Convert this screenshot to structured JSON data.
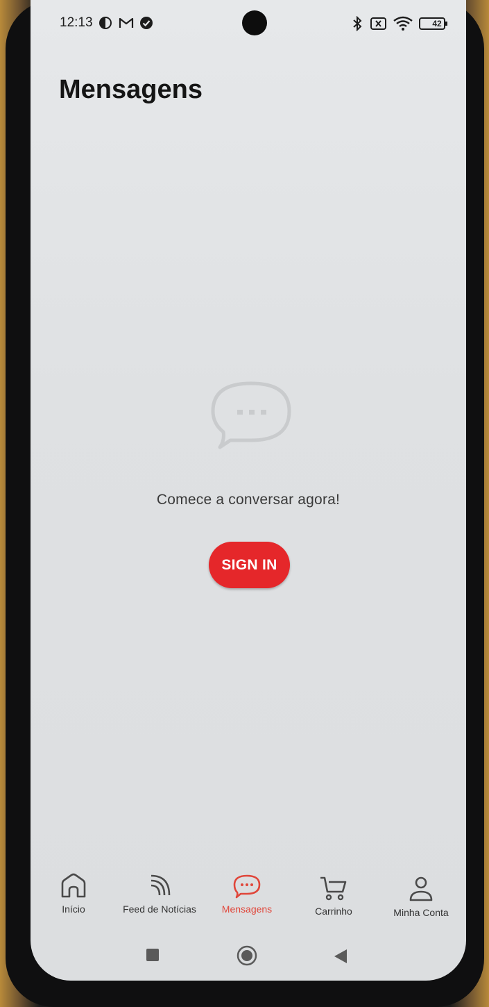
{
  "status_bar": {
    "time": "12:13",
    "battery": "42",
    "icons": [
      "data-saver-icon",
      "gmail-icon",
      "check-circle-icon",
      "bluetooth-icon",
      "no-sim-icon",
      "wifi-icon",
      "battery-icon"
    ]
  },
  "header": {
    "title": "Mensagens"
  },
  "empty_state": {
    "icon": "chat-bubble-icon",
    "message": "Comece a conversar agora!",
    "button_label": "SIGN IN"
  },
  "bottom_nav": {
    "items": [
      {
        "label": "Início",
        "icon": "home-icon",
        "active": false
      },
      {
        "label": "Feed de Notícias",
        "icon": "rss-feed-icon",
        "active": false
      },
      {
        "label": "Mensagens",
        "icon": "chat-icon",
        "active": true
      },
      {
        "label": "Carrinho",
        "icon": "cart-icon",
        "active": false
      },
      {
        "label": "Minha Conta",
        "icon": "user-icon",
        "active": false
      }
    ]
  },
  "system_nav": [
    "recents-button",
    "home-button",
    "back-button"
  ],
  "colors": {
    "accent": "#e5272a",
    "active_nav": "#e0463a",
    "background": "#e2e4e6"
  }
}
